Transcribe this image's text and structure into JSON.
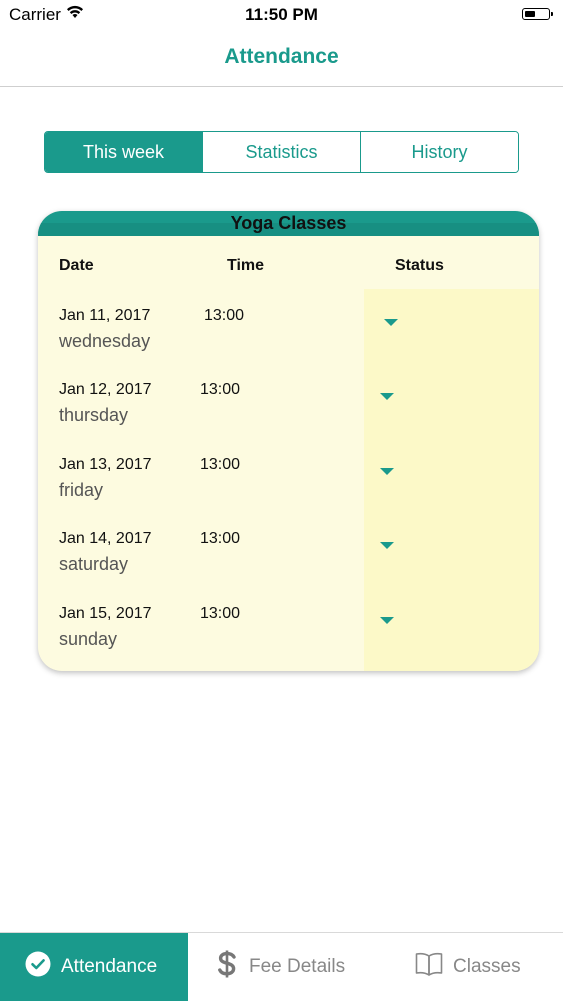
{
  "status_bar": {
    "carrier": "Carrier",
    "time": "11:50 PM"
  },
  "nav": {
    "title": "Attendance"
  },
  "segments": [
    {
      "label": "This week",
      "active": true
    },
    {
      "label": "Statistics",
      "active": false
    },
    {
      "label": "History",
      "active": false
    }
  ],
  "card": {
    "title": "Yoga Classes",
    "headers": {
      "date": "Date",
      "time": "Time",
      "status": "Status"
    },
    "rows": [
      {
        "date": "Jan 11, 2017",
        "day": "wednesday",
        "time": "13:00"
      },
      {
        "date": "Jan 12, 2017",
        "day": "thursday",
        "time": "13:00"
      },
      {
        "date": "Jan 13, 2017",
        "day": "friday",
        "time": "13:00"
      },
      {
        "date": "Jan 14, 2017",
        "day": "saturday",
        "time": "13:00"
      },
      {
        "date": "Jan 15, 2017",
        "day": "sunday",
        "time": "13:00"
      }
    ]
  },
  "tabs": [
    {
      "label": "Attendance",
      "icon": "check-circle-icon",
      "active": true
    },
    {
      "label": "Fee Details",
      "icon": "dollar-icon",
      "active": false
    },
    {
      "label": "Classes",
      "icon": "book-icon",
      "active": false
    }
  ],
  "colors": {
    "accent": "#1a9a8c",
    "card_bg": "#fdfbe0"
  }
}
